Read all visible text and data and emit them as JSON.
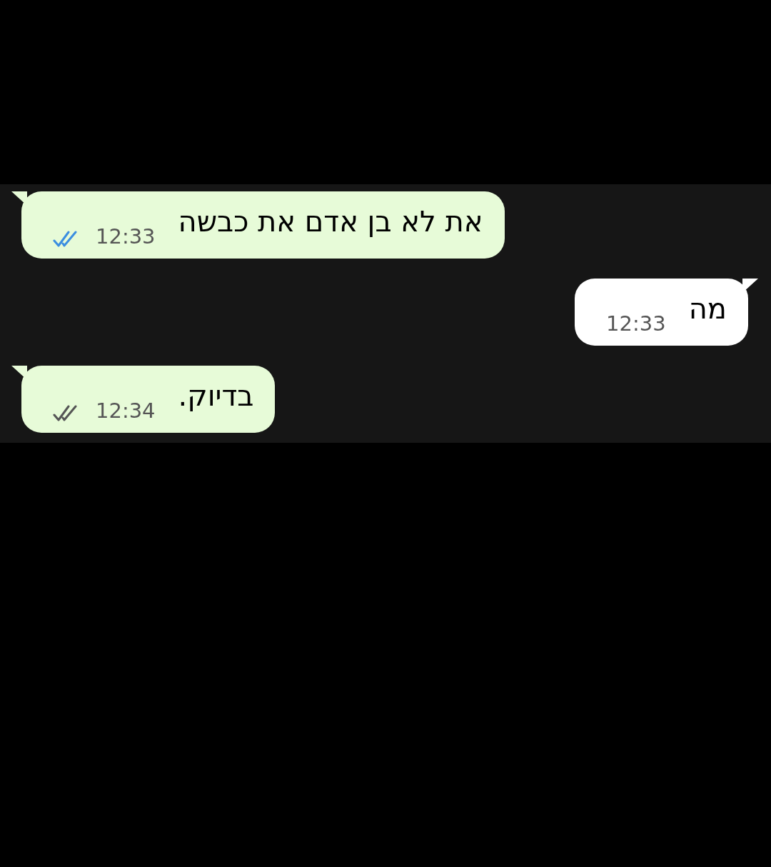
{
  "messages": [
    {
      "kind": "outgoing",
      "text": "את לא בן אדם את כבשה",
      "time": "12:33",
      "read": true
    },
    {
      "kind": "incoming",
      "text": "מה",
      "time": "12:33"
    },
    {
      "kind": "outgoing",
      "text": "בדיוק.",
      "time": "12:34",
      "read": false
    }
  ]
}
